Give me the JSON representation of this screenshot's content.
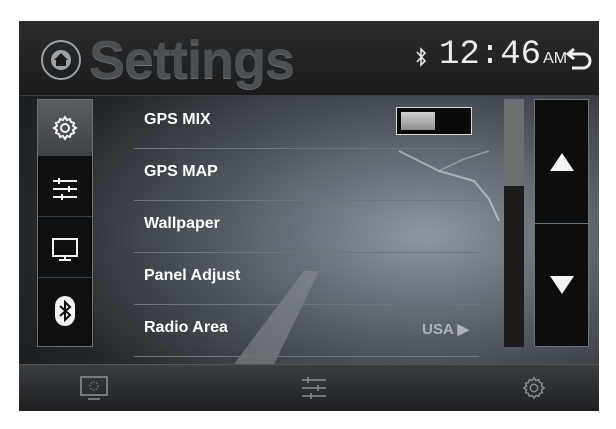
{
  "header": {
    "title": "Settings",
    "time": "12:46",
    "ampm": "AM"
  },
  "side_nav": {
    "items": [
      {
        "icon": "gear-icon",
        "active": true
      },
      {
        "icon": "sliders-icon",
        "active": false
      },
      {
        "icon": "monitor-icon",
        "active": false
      },
      {
        "icon": "bluetooth-icon",
        "active": false
      }
    ]
  },
  "settings_list": [
    {
      "label": "GPS MIX",
      "value": ""
    },
    {
      "label": "GPS MAP",
      "value": ""
    },
    {
      "label": "Wallpaper",
      "value": ""
    },
    {
      "label": "Panel Adjust",
      "value": ""
    },
    {
      "label": "Radio Area",
      "value": "USA"
    }
  ],
  "gps_mix_toggle": {
    "state": "off"
  },
  "scrollbar": {
    "position_fraction": 0.0,
    "visible_fraction": 0.35
  },
  "bottom_bar": {
    "items": [
      {
        "icon": "screen-icon"
      },
      {
        "icon": "equalizer-icon"
      },
      {
        "icon": "gear-icon"
      }
    ]
  },
  "colors": {
    "text": "#ffffff",
    "value_text": "#aeb3b8",
    "title_text": "#4c5054",
    "divider": "#6f7479"
  }
}
